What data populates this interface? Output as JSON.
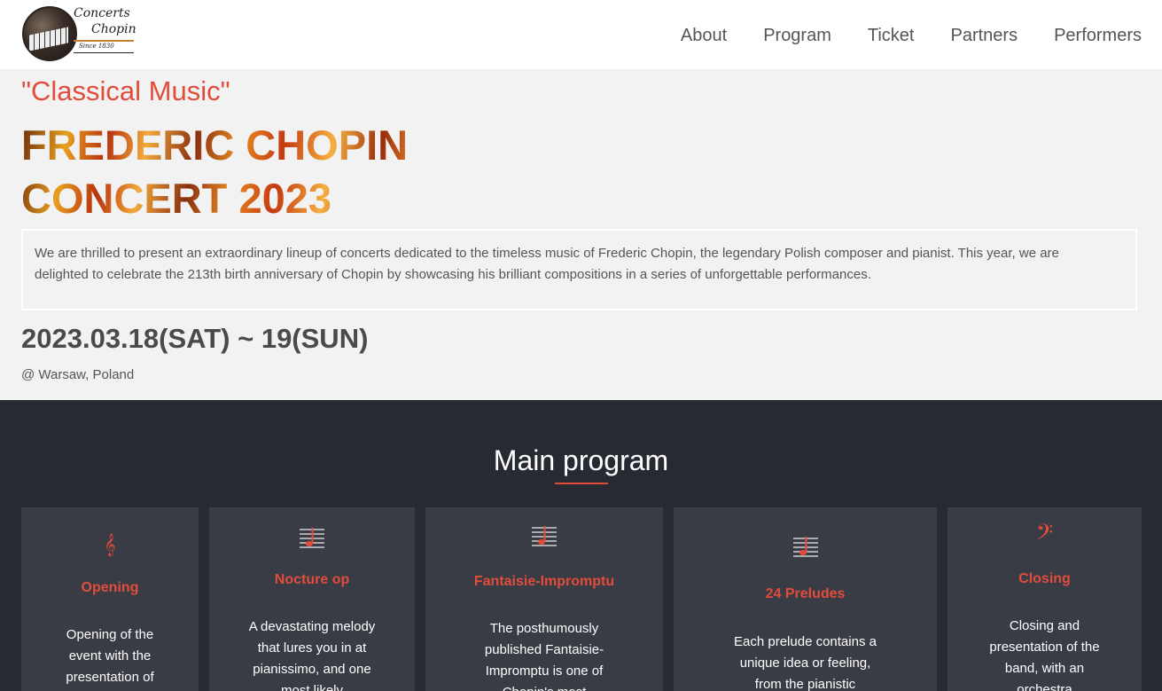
{
  "header": {
    "logo": {
      "line1": "Concerts",
      "line2": "Chopin",
      "line3": "Since 1830"
    },
    "nav": [
      "About",
      "Program",
      "Ticket",
      "Partners",
      "Performers"
    ]
  },
  "hero": {
    "kicker": "\"Classical Music\"",
    "title_line1": "FREDERIC CHOPIN",
    "title_line2": "CONCERT 2023",
    "intro": "We are thrilled to present an extraordinary lineup of concerts dedicated to the timeless music of Frederic Chopin, the legendary Polish composer and pianist. This year, we are delighted to celebrate the 213th birth anniversary of Chopin by showcasing his brilliant compositions in a series of unforgettable performances.",
    "dates": "2023.03.18(SAT) ~ 19(SUN)",
    "place": "@ Warsaw, Poland"
  },
  "program": {
    "title": "Main program",
    "cards": [
      {
        "icon": "treble-clef-icon",
        "title": "Opening",
        "desc": "Opening of the event with the presentation of"
      },
      {
        "icon": "music-staff-icon",
        "title": "Nocture op",
        "desc": "A devastating melody that lures you in at pianissimo, and one most likely"
      },
      {
        "icon": "music-staff-icon",
        "title": "Fantaisie-Impromptu",
        "desc": "The posthumously published Fantaisie-Impromptu is one of Chopin's most"
      },
      {
        "icon": "music-staff-icon",
        "title": "24 Preludes",
        "desc": "Each prelude contains a unique idea or feeling, from the pianistic"
      },
      {
        "icon": "bass-clef-icon",
        "title": "Closing",
        "desc": "Closing and presentation of the band, with an orchestra"
      }
    ]
  },
  "colors": {
    "accent": "#e24d3b",
    "dark_bg": "#282a33",
    "card_bg": "#393b45"
  }
}
